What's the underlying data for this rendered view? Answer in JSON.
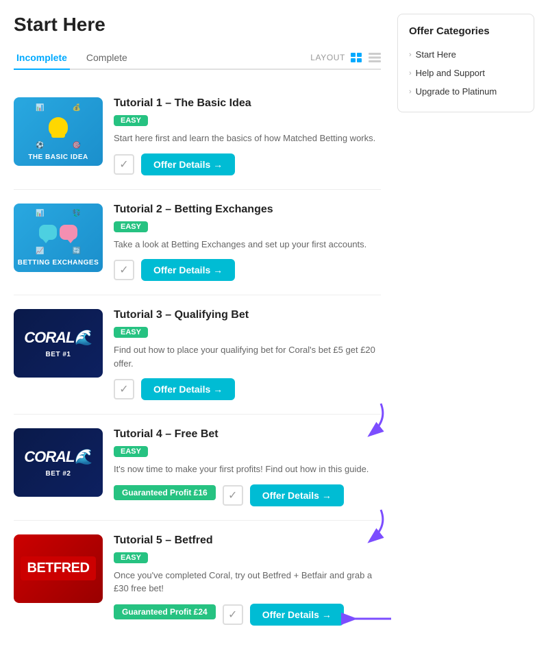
{
  "page": {
    "title": "Start Here"
  },
  "tabs": [
    {
      "id": "incomplete",
      "label": "Incomplete",
      "active": true
    },
    {
      "id": "complete",
      "label": "Complete",
      "active": false
    }
  ],
  "layout": {
    "label": "LAYOUT"
  },
  "tutorials": [
    {
      "id": "tutorial-1",
      "title": "Tutorial 1 – The Basic Idea",
      "badge": "EASY",
      "description": "Start here first and learn the basics of how Matched Betting works.",
      "thumb_type": "basic",
      "thumb_label": "THE BASIC IDEA",
      "profit_badge": null,
      "offer_btn_label": "Offer Details →",
      "has_arrow": false
    },
    {
      "id": "tutorial-2",
      "title": "Tutorial 2 – Betting Exchanges",
      "badge": "EASY",
      "description": "Take a look at Betting Exchanges and set up your first accounts.",
      "thumb_type": "exchanges",
      "thumb_label": "BETTING EXCHANGES",
      "profit_badge": null,
      "offer_btn_label": "Offer Details →",
      "has_arrow": false
    },
    {
      "id": "tutorial-3",
      "title": "Tutorial 3 – Qualifying Bet",
      "badge": "EASY",
      "description": "Find out how to place your qualifying bet for Coral's bet £5 get £20 offer.",
      "thumb_type": "coral1",
      "thumb_label": "BET #1",
      "profit_badge": null,
      "offer_btn_label": "Offer Details →",
      "has_arrow": true
    },
    {
      "id": "tutorial-4",
      "title": "Tutorial 4 – Free Bet",
      "badge": "EASY",
      "description": "It's now time to make your first profits! Find out how in this guide.",
      "thumb_type": "coral2",
      "thumb_label": "BET #2",
      "profit_badge": "Guaranteed Profit  £16",
      "offer_btn_label": "Offer Details →",
      "has_arrow": true
    },
    {
      "id": "tutorial-5",
      "title": "Tutorial 5 – Betfred",
      "badge": "EASY",
      "description": "Once you've completed Coral, try out Betfred + Betfair and grab a £30 free bet!",
      "thumb_type": "betfred",
      "thumb_label": "",
      "profit_badge": "Guaranteed Profit  £24",
      "offer_btn_label": "Offer Details →",
      "has_arrow": true
    }
  ],
  "sidebar": {
    "title": "Offer Categories",
    "items": [
      {
        "label": "Start Here"
      },
      {
        "label": "Help and Support"
      },
      {
        "label": "Upgrade to Platinum"
      }
    ]
  }
}
